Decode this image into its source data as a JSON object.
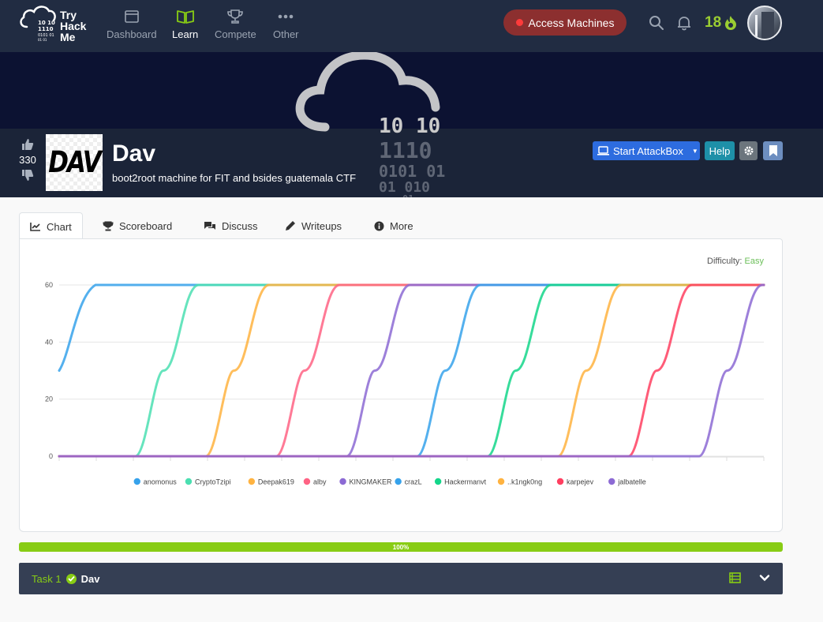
{
  "nav": {
    "logo_text": [
      "Try",
      "Hack",
      "Me"
    ],
    "items": [
      {
        "label": "Dashboard",
        "icon": "dashboard-icon"
      },
      {
        "label": "Learn",
        "icon": "book-icon",
        "active": true
      },
      {
        "label": "Compete",
        "icon": "trophy-icon"
      },
      {
        "label": "Other",
        "icon": "more-dots-icon"
      }
    ],
    "access_label": "Access Machines",
    "streak": "18"
  },
  "room": {
    "votes": "330",
    "logo_text": "DAV",
    "title": "Dav",
    "description": "boot2root machine for FIT and bsides guatemala CTF",
    "attackbox_label": "Start AttackBox",
    "help_label": "Help"
  },
  "tabs": [
    {
      "label": "Chart",
      "icon": "chart-icon",
      "active": true
    },
    {
      "label": "Scoreboard",
      "icon": "trophy-icon"
    },
    {
      "label": "Discuss",
      "icon": "comments-icon"
    },
    {
      "label": "Writeups",
      "icon": "pen-icon"
    },
    {
      "label": "More",
      "icon": "info-icon"
    }
  ],
  "difficulty": {
    "label": "Difficulty:",
    "value": "Easy",
    "color": "#6bbf59"
  },
  "chart_data": {
    "type": "line",
    "ylim": [
      0,
      60
    ],
    "yticks": [
      0,
      20,
      40,
      60
    ],
    "grid": true,
    "legend_position": "bottom",
    "series": [
      {
        "name": "anomonus",
        "color": "#36a2eb"
      },
      {
        "name": "CryptoTzipi",
        "color": "#4bdfb1"
      },
      {
        "name": "Deepak619",
        "color": "#ffb340"
      },
      {
        "name": "alby",
        "color": "#ff6384"
      },
      {
        "name": "KINGMAKER",
        "color": "#8c6ad4"
      },
      {
        "name": "crazL",
        "color": "#36a2eb"
      },
      {
        "name": "Hackermanvt",
        "color": "#14d68a"
      },
      {
        "name": "..k1ngk0ng",
        "color": "#ffb340"
      },
      {
        "name": "karpejev",
        "color": "#ff3f60"
      },
      {
        "name": "jalbatelle",
        "color": "#8c6ad4"
      }
    ]
  },
  "progress": {
    "label": "100%",
    "value": 100
  },
  "task": {
    "number_label": "Task 1",
    "name": "Dav"
  }
}
